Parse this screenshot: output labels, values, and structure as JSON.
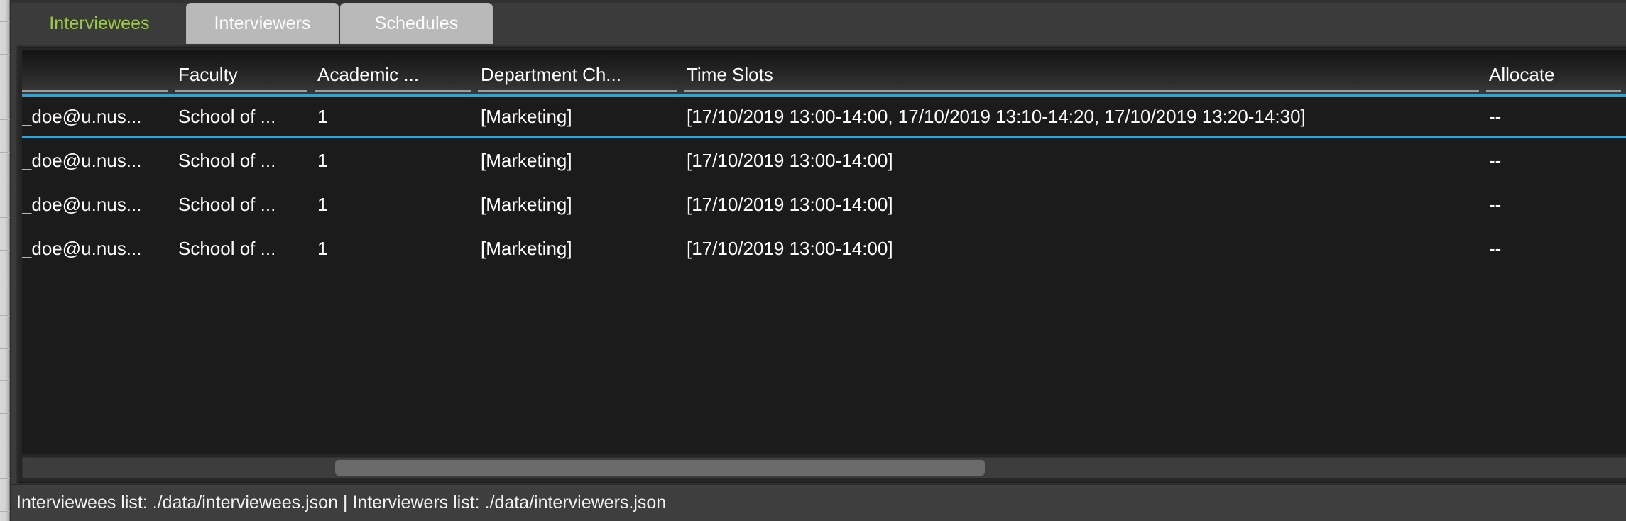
{
  "app": {
    "accent_cyan": "#24a7e0",
    "active_tab_color": "#9acd3a",
    "panel_bg": "#1b1b1b"
  },
  "tabs": [
    {
      "label": "Interviewees",
      "active": true
    },
    {
      "label": "Interviewers",
      "active": false
    },
    {
      "label": "Schedules",
      "active": false
    }
  ],
  "table": {
    "columns": [
      {
        "key": "email",
        "label": ""
      },
      {
        "key": "fac",
        "label": "Faculty"
      },
      {
        "key": "acad",
        "label": "Academic ..."
      },
      {
        "key": "dept",
        "label": "Department Ch..."
      },
      {
        "key": "time",
        "label": "Time Slots"
      },
      {
        "key": "alloc",
        "label": "Allocate"
      }
    ],
    "rows": [
      {
        "selected": true,
        "email": "hn_doe@u.nus...",
        "fac": "School of ...",
        "acad": "1",
        "dept": "[Marketing]",
        "time": "[17/10/2019 13:00-14:00, 17/10/2019 13:10-14:20, 17/10/2019 13:20-14:30]",
        "alloc": "--"
      },
      {
        "selected": false,
        "email": "hn_doe@u.nus...",
        "fac": "School of ...",
        "acad": "1",
        "dept": "[Marketing]",
        "time": "[17/10/2019 13:00-14:00]",
        "alloc": "--"
      },
      {
        "selected": false,
        "email": "hn_doe@u.nus...",
        "fac": "School of ...",
        "acad": "1",
        "dept": "[Marketing]",
        "time": "[17/10/2019 13:00-14:00]",
        "alloc": "--"
      },
      {
        "selected": false,
        "email": "hn_doe@u.nus...",
        "fac": "School of ...",
        "acad": "1",
        "dept": "[Marketing]",
        "time": "[17/10/2019 13:00-14:00]",
        "alloc": "--"
      }
    ]
  },
  "scrollbar": {
    "orientation": "horizontal",
    "thumb_left_percent": 19.5,
    "thumb_width_percent": 40.5
  },
  "statusbar": {
    "text": "Interviewees list: ./data/interviewees.json | Interviewers list: ./data/interviewers.json"
  }
}
